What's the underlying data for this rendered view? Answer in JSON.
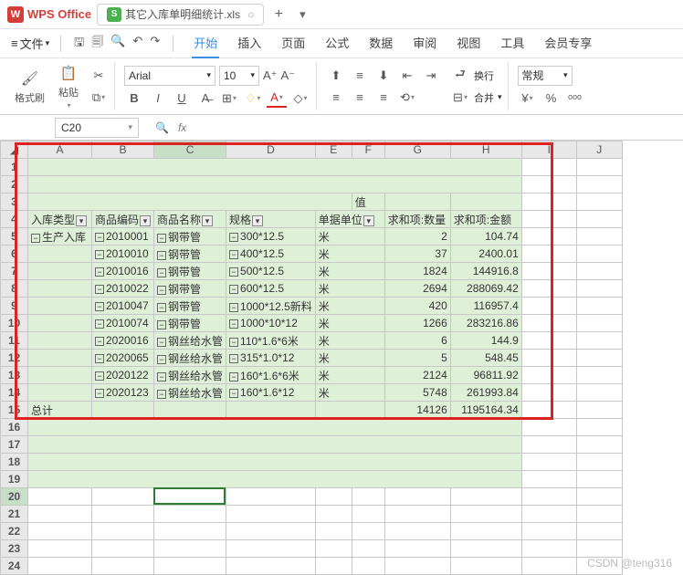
{
  "title_bar": {
    "app": "WPS Office",
    "doc_name": "其它入库单明细统计.xls"
  },
  "menu": {
    "file": "文件",
    "tabs": [
      "开始",
      "插入",
      "页面",
      "公式",
      "数据",
      "审阅",
      "视图",
      "工具",
      "会员专享"
    ],
    "active_tab": "开始"
  },
  "ribbon": {
    "format_painter": "格式刷",
    "paste": "粘贴",
    "font_name": "Arial",
    "font_size": "10",
    "wrap": "换行",
    "merge": "合并",
    "format_menu": "常规"
  },
  "name_box": "C20",
  "fx_label": "fx",
  "col_headers": [
    "A",
    "B",
    "C",
    "D",
    "E",
    "F",
    "G",
    "H",
    "I",
    "J"
  ],
  "table": {
    "pivot_header_value": "值",
    "headers": {
      "A": "入库类型",
      "B": "商品编码",
      "C": "商品名称",
      "D": "规格",
      "E": "单据单位",
      "G": "求和项:数量",
      "H": "求和项:金额"
    },
    "category": "生产入库",
    "totals_label": "总计",
    "rows": [
      {
        "code": "2010001",
        "name": "钢带管",
        "spec": "300*12.5",
        "unit": "米",
        "qty": "2",
        "amt": "104.74"
      },
      {
        "code": "2010010",
        "name": "钢带管",
        "spec": "400*12.5",
        "unit": "米",
        "qty": "37",
        "amt": "2400.01"
      },
      {
        "code": "2010016",
        "name": "钢带管",
        "spec": "500*12.5",
        "unit": "米",
        "qty": "1824",
        "amt": "144916.8"
      },
      {
        "code": "2010022",
        "name": "钢带管",
        "spec": "600*12.5",
        "unit": "米",
        "qty": "2694",
        "amt": "288069.42"
      },
      {
        "code": "2010047",
        "name": "钢带管",
        "spec": "1000*12.5新料",
        "unit": "米",
        "qty": "420",
        "amt": "116957.4"
      },
      {
        "code": "2010074",
        "name": "钢带管",
        "spec": "1000*10*12",
        "unit": "米",
        "qty": "1266",
        "amt": "283216.86"
      },
      {
        "code": "2020016",
        "name": "钢丝给水管",
        "spec": "110*1.6*6米",
        "unit": "米",
        "qty": "6",
        "amt": "144.9"
      },
      {
        "code": "2020065",
        "name": "钢丝给水管",
        "spec": "315*1.0*12",
        "unit": "米",
        "qty": "5",
        "amt": "548.45"
      },
      {
        "code": "2020122",
        "name": "钢丝给水管",
        "spec": "160*1.6*6米",
        "unit": "米",
        "qty": "2124",
        "amt": "96811.92"
      },
      {
        "code": "2020123",
        "name": "钢丝给水管",
        "spec": "160*1.6*12",
        "unit": "米",
        "qty": "5748",
        "amt": "261993.84"
      }
    ],
    "totals": {
      "qty": "14126",
      "amt": "1195164.34"
    }
  },
  "watermark": "CSDN @teng316"
}
